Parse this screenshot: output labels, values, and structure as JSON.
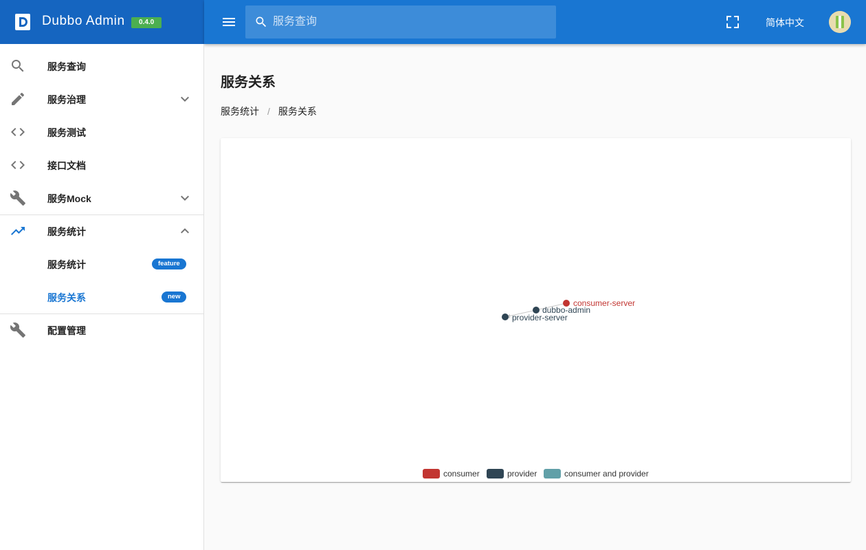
{
  "header": {
    "app_title": "Dubbo Admin",
    "version": "0.4.0",
    "search_placeholder": "服务查询",
    "language": "简体中文"
  },
  "sidebar": {
    "items": [
      {
        "label": "服务查询",
        "icon": "search-icon"
      },
      {
        "label": "服务治理",
        "icon": "pencil-icon",
        "expandable": true
      },
      {
        "label": "服务测试",
        "icon": "code-icon"
      },
      {
        "label": "接口文档",
        "icon": "code-icon"
      },
      {
        "label": "服务Mock",
        "icon": "wrench-icon",
        "expandable": true
      },
      {
        "label": "服务统计",
        "icon": "trending-up-icon",
        "expanded": true
      },
      {
        "label": "服务统计",
        "badge": "feature"
      },
      {
        "label": "服务关系",
        "badge": "new",
        "active": true
      },
      {
        "label": "配置管理",
        "icon": "wrench-icon"
      }
    ]
  },
  "main": {
    "page_title": "服务关系",
    "breadcrumb": [
      "服务统计",
      "服务关系"
    ]
  },
  "graph": {
    "nodes": [
      {
        "name": "consumer-server",
        "category": "consumer"
      },
      {
        "name": "dubbo-admin",
        "category": "provider"
      },
      {
        "name": "provider-server",
        "category": "provider"
      }
    ],
    "links": [
      {
        "source": "consumer-server",
        "target": "dubbo-admin"
      },
      {
        "source": "dubbo-admin",
        "target": "provider-server"
      }
    ],
    "legend": [
      {
        "name": "consumer",
        "color": "#c23531"
      },
      {
        "name": "provider",
        "color": "#2f4554"
      },
      {
        "name": "consumer and provider",
        "color": "#61a0a8"
      }
    ]
  },
  "colors": {
    "primary": "#1976d2",
    "brand": "#1565c0",
    "version_badge": "#4caf50"
  }
}
